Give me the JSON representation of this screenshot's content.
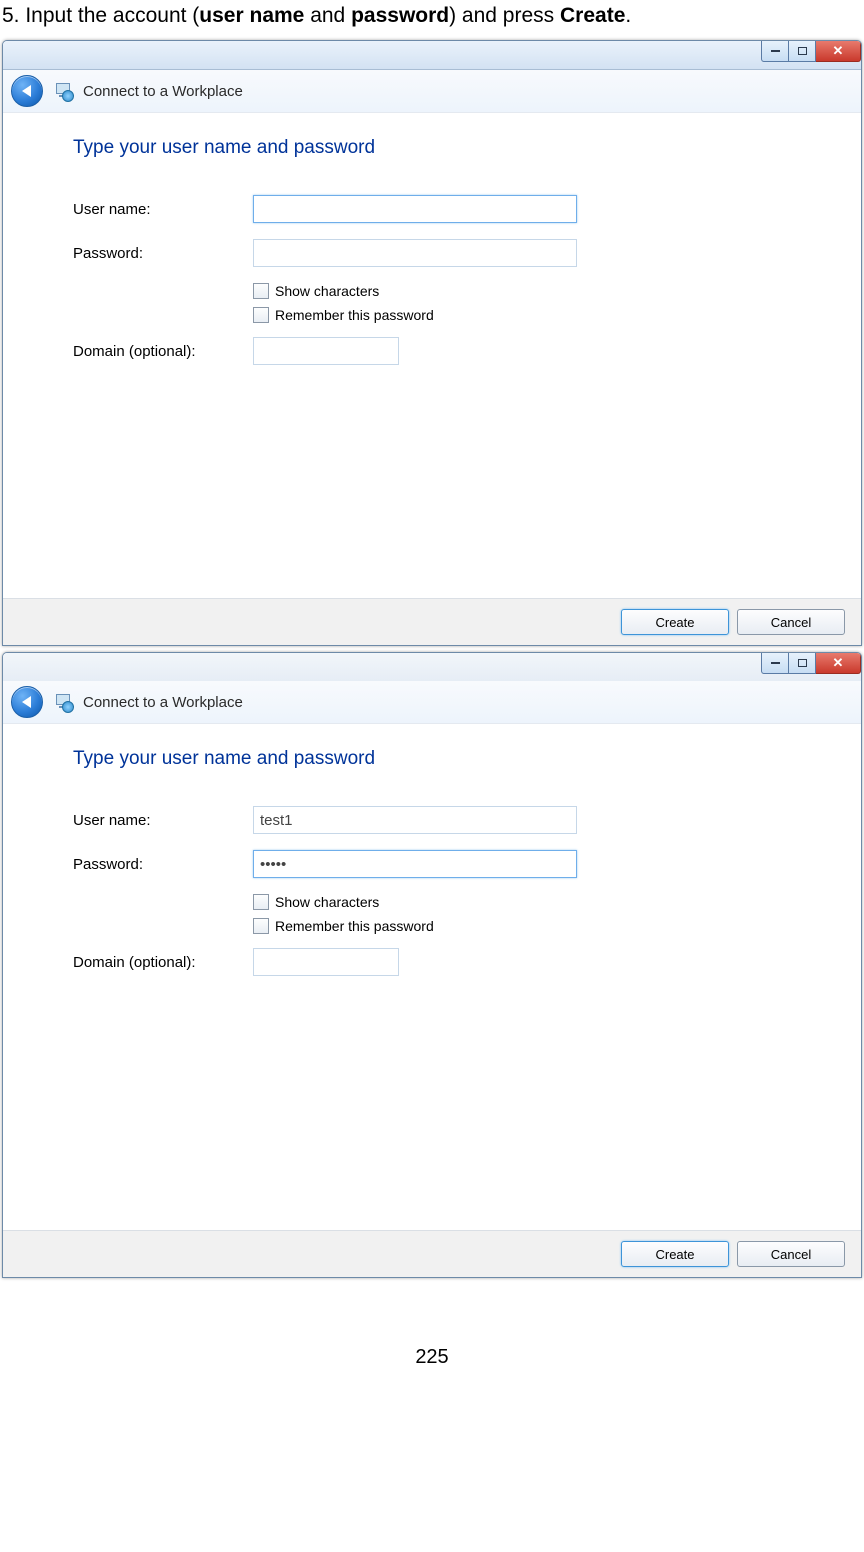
{
  "instruction": {
    "prefix": "5. Input the account (",
    "username_label": "user name",
    "mid": " and ",
    "password_label": "password",
    "suffix1": ") and press ",
    "create_label": "Create",
    "suffix2": "."
  },
  "window1": {
    "title": "Connect to a Workplace",
    "heading": "Type your user name and password",
    "labels": {
      "username": "User name:",
      "password": "Password:",
      "show_chars": "Show characters",
      "remember": "Remember this password",
      "domain": "Domain (optional):"
    },
    "values": {
      "username": "",
      "password": "",
      "domain": ""
    },
    "buttons": {
      "create": "Create",
      "cancel": "Cancel"
    }
  },
  "window2": {
    "title": "Connect to a Workplace",
    "heading": "Type your user name and password",
    "labels": {
      "username": "User name:",
      "password": "Password:",
      "show_chars": "Show characters",
      "remember": "Remember this password",
      "domain": "Domain (optional):"
    },
    "values": {
      "username": "test1",
      "password": "•••••",
      "domain": ""
    },
    "buttons": {
      "create": "Create",
      "cancel": "Cancel"
    }
  },
  "page_number": "225"
}
